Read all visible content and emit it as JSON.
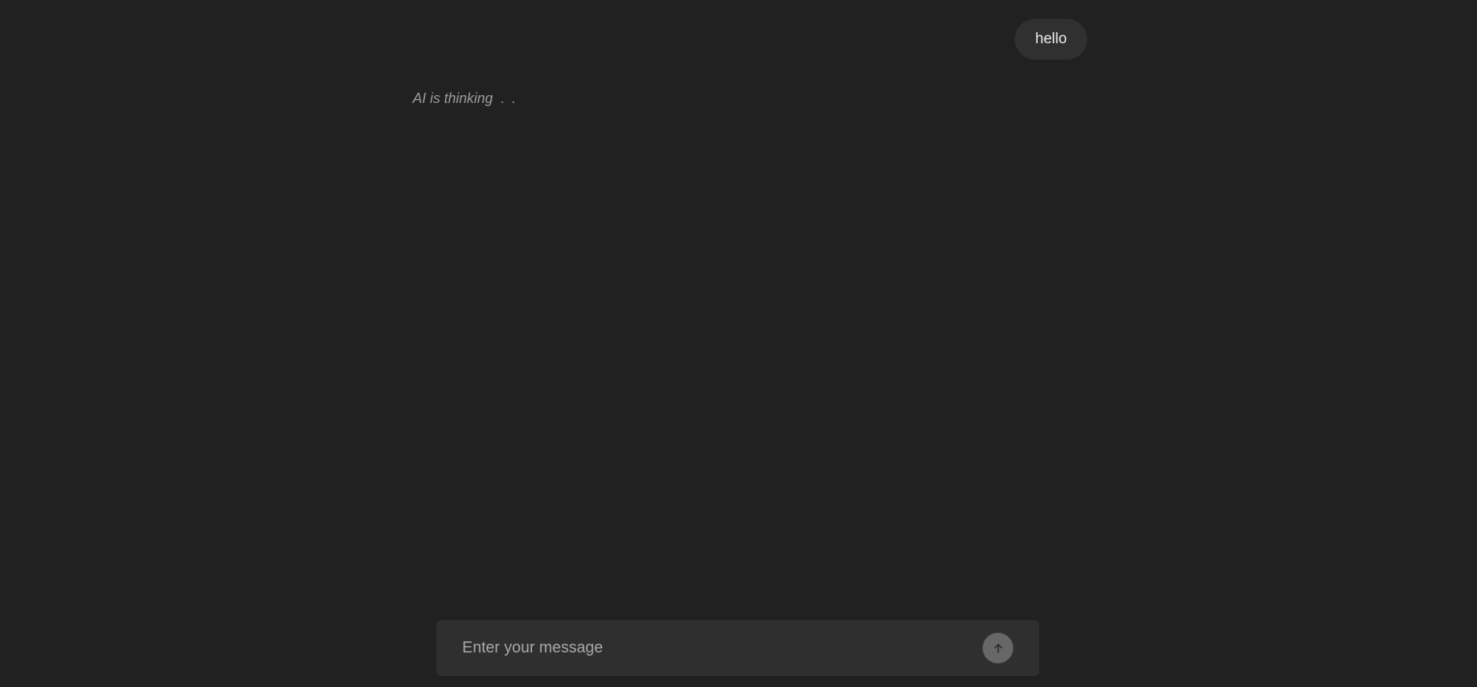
{
  "messages": [
    {
      "role": "user",
      "text": "hello"
    }
  ],
  "status": {
    "thinking_text": "AI is thinking",
    "dots": ". ."
  },
  "composer": {
    "placeholder": "Enter your message",
    "value": "",
    "send_icon": "arrow-up-icon"
  },
  "colors": {
    "background": "#212121",
    "bubble": "#303030",
    "composer": "#2f2f2f",
    "send_button": "#676767"
  }
}
